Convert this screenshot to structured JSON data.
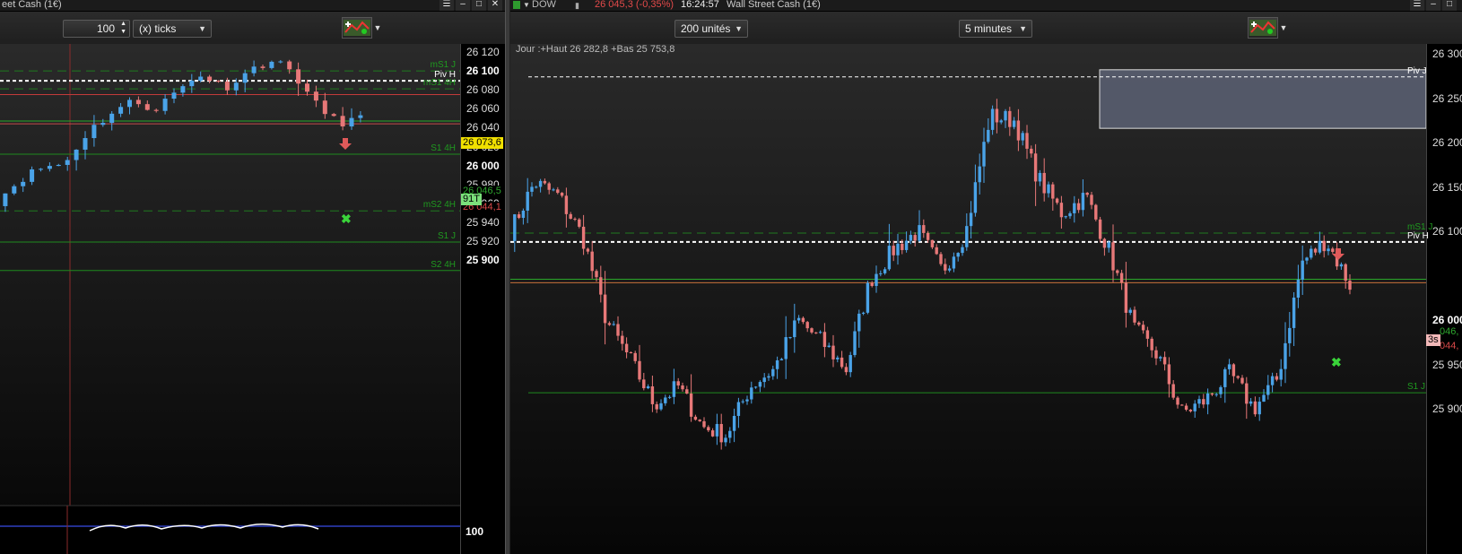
{
  "left": {
    "title": "eet Cash (1€)",
    "quantity": "100",
    "unit_select": "(x) ticks",
    "y_ticks": [
      {
        "v": 26120,
        "label": "26 120",
        "bold": false
      },
      {
        "v": 26100,
        "label": "26 100",
        "bold": true
      },
      {
        "v": 26080,
        "label": "26 080",
        "bold": false
      },
      {
        "v": 26060,
        "label": "26 060",
        "bold": false
      },
      {
        "v": 26040,
        "label": "26 040",
        "bold": false
      },
      {
        "v": 26020,
        "label": "26 020",
        "bold": false
      },
      {
        "v": 26000,
        "label": "26 000",
        "bold": true
      },
      {
        "v": 25980,
        "label": "25 980",
        "bold": false
      },
      {
        "v": 25960,
        "label": "25 960",
        "bold": false
      },
      {
        "v": 25940,
        "label": "25 940",
        "bold": false
      },
      {
        "v": 25920,
        "label": "25 920",
        "bold": false
      },
      {
        "v": 25900,
        "label": "25 900",
        "bold": true
      }
    ],
    "levels": [
      {
        "label": "mS1 J",
        "color": "#1f9a1f"
      },
      {
        "label": "Piv H",
        "color": "#ffffff"
      },
      {
        "label": "mS1 4H",
        "color": "#1f9a1f"
      },
      {
        "label": "S1 4H",
        "color": "#1f9a1f"
      },
      {
        "label": "mS2 4H",
        "color": "#1f9a1f"
      },
      {
        "label": "S1 J",
        "color": "#1f9a1f"
      },
      {
        "label": "S2 4H",
        "color": "#1f9a1f"
      }
    ],
    "price_tags": [
      {
        "label": "26 073,6",
        "bg": "#f0e000",
        "fg": "#000"
      },
      {
        "label": "26 046,5",
        "bg": "#000",
        "fg": "#2ea82e"
      },
      {
        "label": "26 044,1",
        "bg": "#000",
        "fg": "#d84848"
      },
      {
        "label": "91T",
        "bg": "#7be07b",
        "fg": "#000"
      }
    ],
    "indicator_label": "100"
  },
  "right": {
    "title_symbol": "DOW",
    "title_price": "26 045,3 (-0,35%)",
    "title_time": "16:24:57",
    "title_name": "Wall Street Cash (1€)",
    "units_select": "200 unités",
    "interval_select": "5 minutes",
    "day_info": "Jour :+Haut 26 282,8 +Bas 25 753,8",
    "y_ticks": [
      {
        "v": 26300,
        "label": "26 300",
        "bold": false
      },
      {
        "v": 26250,
        "label": "26 250",
        "bold": false
      },
      {
        "v": 26200,
        "label": "26 200",
        "bold": false
      },
      {
        "v": 26150,
        "label": "26 150",
        "bold": false
      },
      {
        "v": 26100,
        "label": "26 100",
        "bold": false
      },
      {
        "v": 26000,
        "label": "26 000",
        "bold": true
      },
      {
        "v": 25950,
        "label": "25 950",
        "bold": false
      },
      {
        "v": 25900,
        "label": "25 900",
        "bold": false
      }
    ],
    "levels": [
      {
        "label": "Piv J",
        "color": "#ffffff"
      },
      {
        "label": "mS1 J",
        "color": "#1f9a1f"
      },
      {
        "label": "Piv H",
        "color": "#ffffff"
      },
      {
        "label": "S1 J",
        "color": "#1f9a1f"
      }
    ],
    "price_tags": [
      {
        "label": "046,",
        "bg": "#000",
        "fg": "#2ea82e"
      },
      {
        "label": "044,",
        "bg": "#000",
        "fg": "#d84848"
      },
      {
        "label": "3s",
        "bg": "#f2b8b8",
        "fg": "#000"
      }
    ],
    "colors": {
      "up": "#4aa3e8",
      "down": "#e77878",
      "zone": "#5c6274"
    }
  }
}
